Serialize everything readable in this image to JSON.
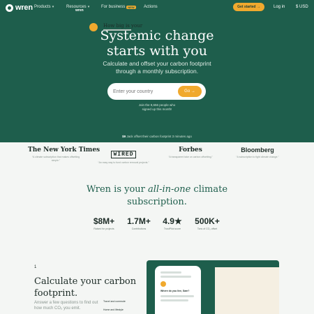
{
  "nav": {
    "brand": "wren",
    "items": [
      {
        "label": "Products",
        "chevron": "▾"
      },
      {
        "label": "Resources",
        "chevron": "▾"
      },
      {
        "label": "For business",
        "badge": "NEW"
      },
      {
        "label": "Actions"
      }
    ],
    "cta": "Get started →",
    "login": "Log in",
    "currency": "$ USD"
  },
  "hero": {
    "title_line1": "Systemic change",
    "title_line2": "starts with you",
    "subtitle_line1": "Calculate and offset your carbon footprint",
    "subtitle_line2": "through a monthly subscription.",
    "country_placeholder": "Enter your country",
    "go_label": "Go →",
    "join_line1": "Join the 8,656 people who",
    "join_line2": "signed up this month!",
    "ticker_name": "$9",
    "ticker_text": "Jack offset their carbon footprint",
    "ticker_time": "3 minutes ago"
  },
  "press": [
    {
      "name": "The New York Times",
      "quote": "“A climate subscription that makes offsetting simple.”"
    },
    {
      "name": "WIRED",
      "quote": "“An easy way to fund carbon removal projects.”"
    },
    {
      "name": "Forbes",
      "quote": "“A transparent take on carbon offsetting.”"
    },
    {
      "name": "Bloomberg",
      "quote": "“A subscription to fight climate change.”"
    }
  ],
  "subscription": {
    "title_pre": "Wren is your ",
    "title_em": "all-in-one",
    "title_post": " climate",
    "title_line2": "subscription.",
    "stats": [
      {
        "value": "$8M+",
        "label": "Raised for projects"
      },
      {
        "value": "1.7M+",
        "label": "Contributions"
      },
      {
        "value": "4.9★",
        "label": "TrustPilot score"
      },
      {
        "value": "500K+",
        "label": "Tons of CO₂ offset"
      }
    ]
  },
  "step": {
    "number": "1",
    "title_line1": "Calculate your carbon",
    "title_line2": "footprint.",
    "desc_line1": "Answer a few questions to find out",
    "desc_line2": "how much CO₂ you emit."
  },
  "mockup": {
    "phone_question": "Where do you live, Sam?",
    "panel_brand": "wren",
    "panel_title": "How big is your",
    "panel_label1": "Travel and commute",
    "panel_label2": "Home and lifestyle"
  },
  "colors": {
    "brand_green": "#1e5e4c",
    "accent_orange": "#f0a92e",
    "background": "#f4f6f4"
  }
}
